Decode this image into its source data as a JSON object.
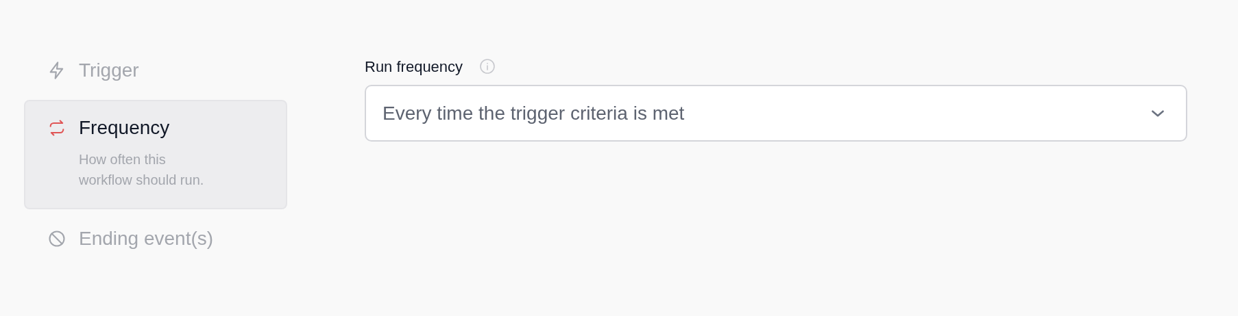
{
  "steps": [
    {
      "kind": "trigger",
      "label": "Trigger",
      "selected": false
    },
    {
      "kind": "frequency",
      "label": "Frequency",
      "description": "How often this workflow should run.",
      "selected": true
    },
    {
      "kind": "ending",
      "label": "Ending event(s)",
      "selected": false
    }
  ],
  "run_frequency": {
    "label": "Run frequency",
    "value": "Every time the trigger criteria is met"
  }
}
